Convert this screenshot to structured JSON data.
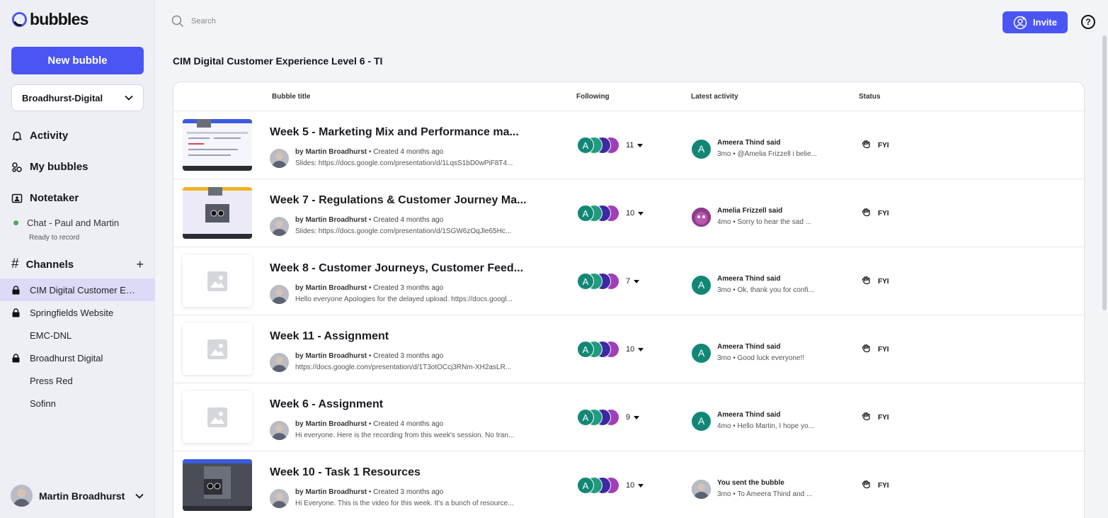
{
  "app": {
    "name": "bubbles"
  },
  "sidebar": {
    "new_bubble_label": "New bubble",
    "workspace": "Broadhurst-Digital",
    "nav": {
      "activity": "Activity",
      "my_bubbles": "My bubbles",
      "notetaker": "Notetaker"
    },
    "chat": {
      "label": "Chat - Paul and Martin",
      "status": "Ready to record"
    },
    "channels_label": "Channels",
    "channels": [
      {
        "label": "CIM Digital Customer Experience Level 6 - TI",
        "locked": true,
        "active": true
      },
      {
        "label": "Springfields Website",
        "locked": true
      },
      {
        "label": "EMC-DNL",
        "locked": false
      },
      {
        "label": "Broadhurst Digital",
        "locked": true
      },
      {
        "label": "Press Red",
        "locked": false
      },
      {
        "label": "Sofinn",
        "locked": false
      }
    ],
    "user_name": "Martin Broadhurst"
  },
  "header": {
    "search_placeholder": "Search",
    "invite_label": "Invite",
    "help_icon": "?"
  },
  "page_title": "CIM Digital Customer Experience Level 6 - TI",
  "table": {
    "columns": {
      "title": "Bubble title",
      "following": "Following",
      "activity": "Latest activity",
      "status": "Status"
    },
    "rows": [
      {
        "title": "Week 5 - Marketing Mix and Performance ma...",
        "author": "by Martin Broadhurst",
        "created": " • Created 4 months ago",
        "desc": "Slides: https://docs.google.com/presentation/d/1LqsS1bD0wPiF8T4...",
        "following_count": "11",
        "activity_who": "Ameera Thind said",
        "activity_msg": "3mo • @Amelia Frizzell i belie...",
        "activity_avatar": "A",
        "status": "FYI",
        "thumb": "video-light"
      },
      {
        "title": "Week 7 - Regulations & Customer Journey Ma...",
        "author": "by Martin Broadhurst",
        "created": " • Created 4 months ago",
        "desc": "Slides: https://docs.google.com/presentation/d/1SGW6zOqJle65Hc...",
        "following_count": "10",
        "activity_who": "Amelia Frizzell said",
        "activity_msg": "4mo • Sorry to hear the sad ...",
        "activity_avatar": "",
        "status": "FYI",
        "thumb": "video-slide"
      },
      {
        "title": "Week 8 - Customer Journeys, Customer Feed...",
        "author": "by Martin Broadhurst",
        "created": " • Created 3 months ago",
        "desc": "Hello everyone Apologies for the delayed upload. https://docs.googl...",
        "following_count": "7",
        "activity_who": "Ameera Thind said",
        "activity_msg": "3mo • Ok, thank you for confi...",
        "activity_avatar": "A",
        "status": "FYI",
        "thumb": "placeholder"
      },
      {
        "title": "Week 11 - Assignment",
        "author": "by Martin Broadhurst",
        "created": " • Created 3 months ago",
        "desc": "https://docs.google.com/presentation/d/1T3otOCcj3RNm-XH2asLR...",
        "following_count": "10",
        "activity_who": "Ameera Thind said",
        "activity_msg": "3mo • Good luck everyone!!",
        "activity_avatar": "A",
        "status": "FYI",
        "thumb": "placeholder"
      },
      {
        "title": "Week 6 - Assignment",
        "author": "by Martin Broadhurst",
        "created": " • Created 4 months ago",
        "desc": "Hi everyone. Here is the recording from this week's session. No tran...",
        "following_count": "9",
        "activity_who": "Ameera Thind said",
        "activity_msg": "4mo • Hello Martin, I hope yo...",
        "activity_avatar": "A",
        "status": "FYI",
        "thumb": "placeholder"
      },
      {
        "title": "Week 10 - Task 1 Resources",
        "author": "by Martin Broadhurst",
        "created": " • Created 3 months ago",
        "desc": "Hi Everyone. This is the video for this week. It's a bunch of resource...",
        "following_count": "10",
        "activity_who": "You sent the bubble",
        "activity_msg": "3mo • To Ameera Thind and ...",
        "activity_avatar": "",
        "status": "FYI",
        "thumb": "video-dark"
      }
    ],
    "follower_initials": [
      "A",
      "",
      "",
      ""
    ]
  },
  "colors": {
    "accent": "#4b55f4",
    "active_channel": "#dcdaf7",
    "teal": "#138776"
  }
}
